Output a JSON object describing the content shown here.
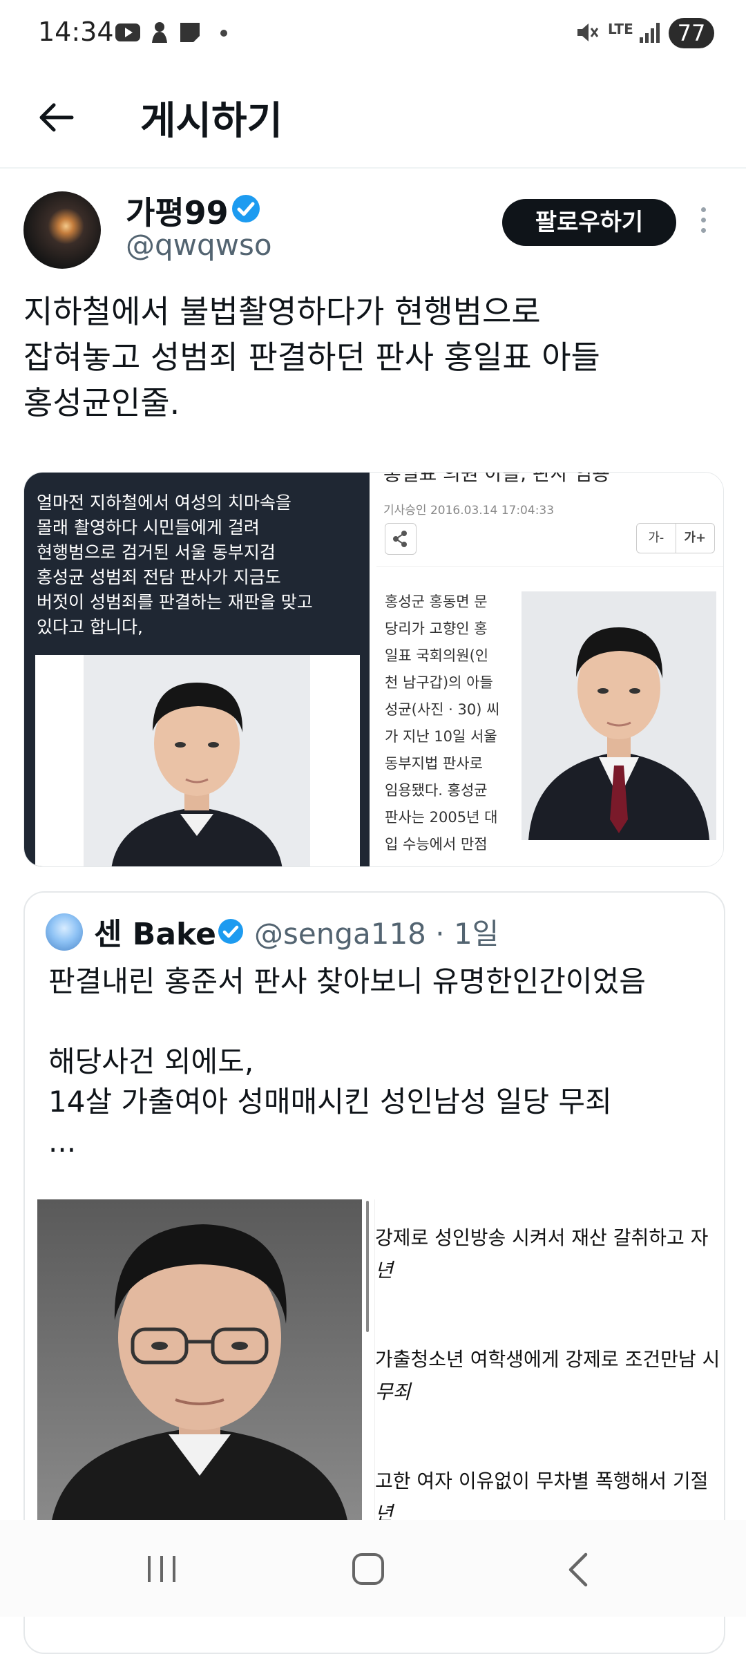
{
  "status_bar": {
    "time": "14:34",
    "network": "LTE",
    "battery": "77"
  },
  "header": {
    "title": "게시하기"
  },
  "tweet": {
    "display_name": "가평99",
    "handle": "@qwqwso",
    "follow_label": "팔로우하기",
    "text_lines": [
      "지하철에서 불법촬영하다가 현행범으로",
      "잡혀놓고 성범죄 판결하던 판사 홍일표 아들",
      "홍성균인줄."
    ],
    "media": {
      "left_caption": [
        "얼마전 지하철에서 여성의 치마속을",
        "몰래 촬영하다 시민들에게 걸려",
        "현행범으로 검거된 서울 동부지검",
        "홍성균 성범죄 전담 판사가 지금도",
        "버젓이 성범죄를 판결하는 재판을 맞고",
        "있다고 합니다,"
      ],
      "right_title": "홍일표 의원 아들, 판사 임용",
      "right_date": "기사승인 2016.03.14  17:04:33",
      "font_small": "가-",
      "font_large": "가+",
      "article_lines": [
        "홍성군 홍동면 문",
        "당리가 고향인 홍",
        "일표 국회의원(인",
        "천 남구갑)의 아들",
        "성균(사진 · 30) 씨",
        "가 지난 10일 서울",
        "동부지법 판사로",
        "임용됐다. 홍성균",
        "판사는 2005년 대",
        "입 수능에서 만점"
      ]
    }
  },
  "quote": {
    "display_name": "센 Bake",
    "handle": "@senga118 · 1일",
    "text_lines": [
      "판결내린 홍준서 판사 찾아보니 유명한인간이었음",
      "",
      "해당사건 외에도,",
      "14살 가출여아 성매매시킨 성인남성 일당 무죄",
      "..."
    ],
    "image_lines": [
      "강제로 성인방송 시켜서 재산 갈취하고 자",
      "년",
      "가출청소년 여학생에게 강제로 조건만남 시",
      "무죄",
      "고한 여자 이유없이 무차별 폭행해서 기절",
      "년"
    ]
  },
  "colors": {
    "text": "#0f1419",
    "secondary": "#536471",
    "verified": "#1d9bf0",
    "follow_bg": "#0f1419"
  }
}
